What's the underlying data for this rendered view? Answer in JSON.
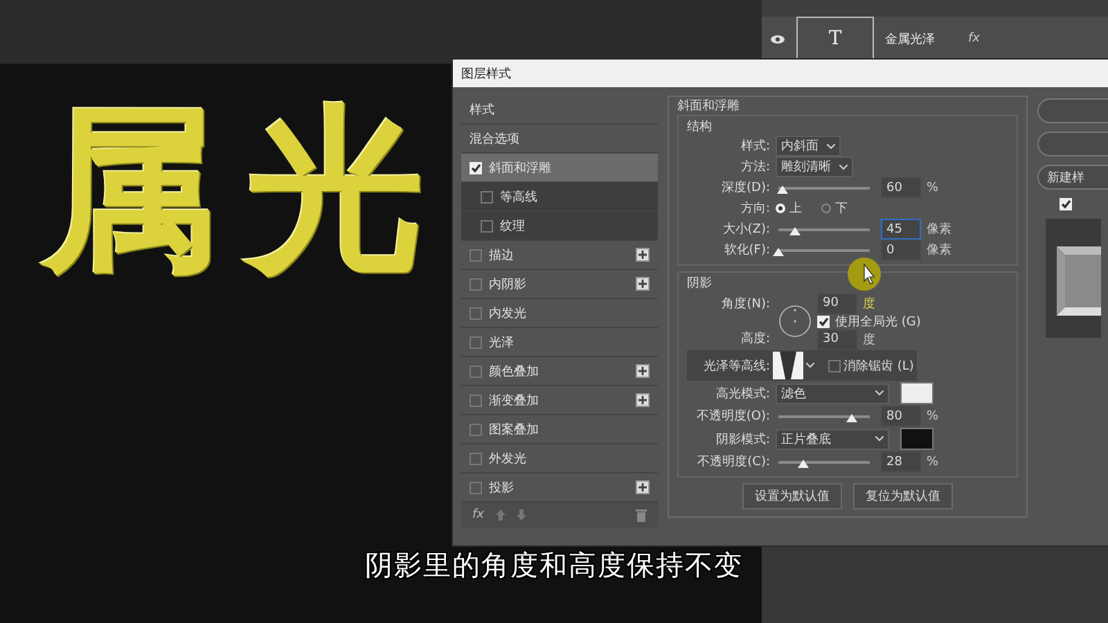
{
  "canvas": {
    "text": "属光"
  },
  "layers_panel": {
    "layer": {
      "thumb": "T",
      "name": "金属光泽",
      "fx": "fx"
    }
  },
  "dialog": {
    "title": "图层样式",
    "styles": [
      {
        "kind": "header",
        "label": "样式",
        "selected": false
      },
      {
        "kind": "header",
        "label": "混合选项",
        "selected": false
      },
      {
        "kind": "effect",
        "label": "斜面和浮雕",
        "checked": true,
        "selected": true,
        "add": false
      },
      {
        "kind": "sub",
        "label": "等高线",
        "checked": false,
        "selected": false
      },
      {
        "kind": "sub",
        "label": "纹理",
        "checked": false,
        "selected": false
      },
      {
        "kind": "effect",
        "label": "描边",
        "checked": false,
        "selected": false,
        "add": true
      },
      {
        "kind": "effect",
        "label": "内阴影",
        "checked": false,
        "selected": false,
        "add": true
      },
      {
        "kind": "effect",
        "label": "内发光",
        "checked": false,
        "selected": false,
        "add": false
      },
      {
        "kind": "effect",
        "label": "光泽",
        "checked": false,
        "selected": false,
        "add": false
      },
      {
        "kind": "effect",
        "label": "颜色叠加",
        "checked": false,
        "selected": false,
        "add": true
      },
      {
        "kind": "effect",
        "label": "渐变叠加",
        "checked": false,
        "selected": false,
        "add": true
      },
      {
        "kind": "effect",
        "label": "图案叠加",
        "checked": false,
        "selected": false,
        "add": false
      },
      {
        "kind": "effect",
        "label": "外发光",
        "checked": false,
        "selected": false,
        "add": false
      },
      {
        "kind": "effect",
        "label": "投影",
        "checked": false,
        "selected": false,
        "add": true
      }
    ],
    "fx": "fx",
    "bevel": {
      "title": "斜面和浮雕",
      "structure": {
        "title": "结构",
        "rows": [
          {
            "kind": "select",
            "label": "样式:",
            "value": "内斜面"
          },
          {
            "kind": "select",
            "label": "方法:",
            "value": "雕刻清晰"
          },
          {
            "kind": "slider",
            "label": "深度(D):",
            "level": 0.05,
            "value": "60",
            "unit": "%",
            "focused": false
          },
          {
            "kind": "radio",
            "label": "方向:",
            "options": [
              {
                "label": "上",
                "selected": true
              },
              {
                "label": "下",
                "selected": false
              }
            ]
          },
          {
            "kind": "slider",
            "label": "大小(Z):",
            "level": 0.18,
            "value": "45",
            "unit": "像素",
            "focused": true
          },
          {
            "kind": "slider",
            "label": "软化(F):",
            "level": 0,
            "value": "0",
            "unit": "像素",
            "focused": false
          }
        ]
      },
      "shading": {
        "title": "阴影",
        "angle": {
          "label": "角度(N):",
          "value": "90",
          "unit": "度"
        },
        "global_light": {
          "label": "使用全局光 (G)",
          "checked": true
        },
        "altitude": {
          "label": "高度:",
          "value": "30",
          "unit": "度"
        },
        "rows": [
          {
            "kind": "contour",
            "label": "光泽等高线:",
            "check_label": "消除锯齿 (L)",
            "checked": false
          },
          {
            "kind": "mode",
            "label": "高光模式:",
            "value": "滤色",
            "color": "#eeeeee"
          },
          {
            "kind": "slider",
            "label": "不透明度(O):",
            "level": 0.8,
            "value": "80",
            "unit": "%",
            "focused": false
          },
          {
            "kind": "mode",
            "label": "阴影模式:",
            "value": "正片叠底",
            "color": "#111111"
          },
          {
            "kind": "slider",
            "label": "不透明度(C):",
            "level": 0.28,
            "value": "28",
            "unit": "%",
            "focused": false
          }
        ]
      },
      "buttons": [
        "设置为默认值",
        "复位为默认值"
      ]
    },
    "side_buttons": [
      {
        "label": "新建样"
      }
    ],
    "preview": {
      "checked": true
    }
  },
  "caption": "阴影里的角度和高度保持不变"
}
